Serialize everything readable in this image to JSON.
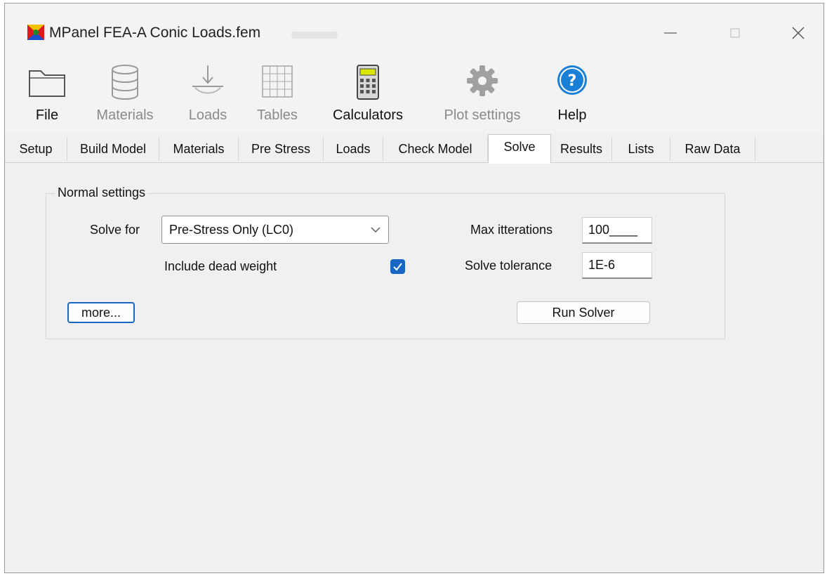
{
  "window": {
    "title": "MPanel FEA-A  Conic Loads.fem"
  },
  "toolbar": {
    "items": [
      {
        "label": "File",
        "icon": "folder-icon",
        "enabled": true
      },
      {
        "label": "Materials",
        "icon": "database-icon",
        "enabled": false
      },
      {
        "label": "Loads",
        "icon": "load-arrow-icon",
        "enabled": false
      },
      {
        "label": "Tables",
        "icon": "table-grid-icon",
        "enabled": false
      },
      {
        "label": "Calculators",
        "icon": "calculator-icon",
        "enabled": true
      },
      {
        "label": "Plot settings",
        "icon": "gear-icon",
        "enabled": false
      },
      {
        "label": "Help",
        "icon": "help-icon",
        "enabled": true
      }
    ]
  },
  "tabs": [
    {
      "label": "Setup"
    },
    {
      "label": "Build Model"
    },
    {
      "label": "Materials"
    },
    {
      "label": "Pre Stress"
    },
    {
      "label": "Loads"
    },
    {
      "label": "Check Model"
    },
    {
      "label": "Solve",
      "active": true
    },
    {
      "label": "Results"
    },
    {
      "label": "Lists"
    },
    {
      "label": "Raw Data"
    }
  ],
  "solve": {
    "group_title": "Normal settings",
    "solve_for_label": "Solve for",
    "solve_for_value": "Pre-Stress Only (LC0)",
    "dead_weight_label": "Include dead weight",
    "dead_weight_checked": true,
    "max_iter_label": "Max itterations",
    "max_iter_value": "100____",
    "tolerance_label": "Solve tolerance",
    "tolerance_value": "1E-6",
    "more_button": "more...",
    "run_button": "Run Solver"
  },
  "colors": {
    "accent": "#1766c4",
    "help_blue": "#1a7fd6",
    "calculator_screen": "#d8e600"
  }
}
